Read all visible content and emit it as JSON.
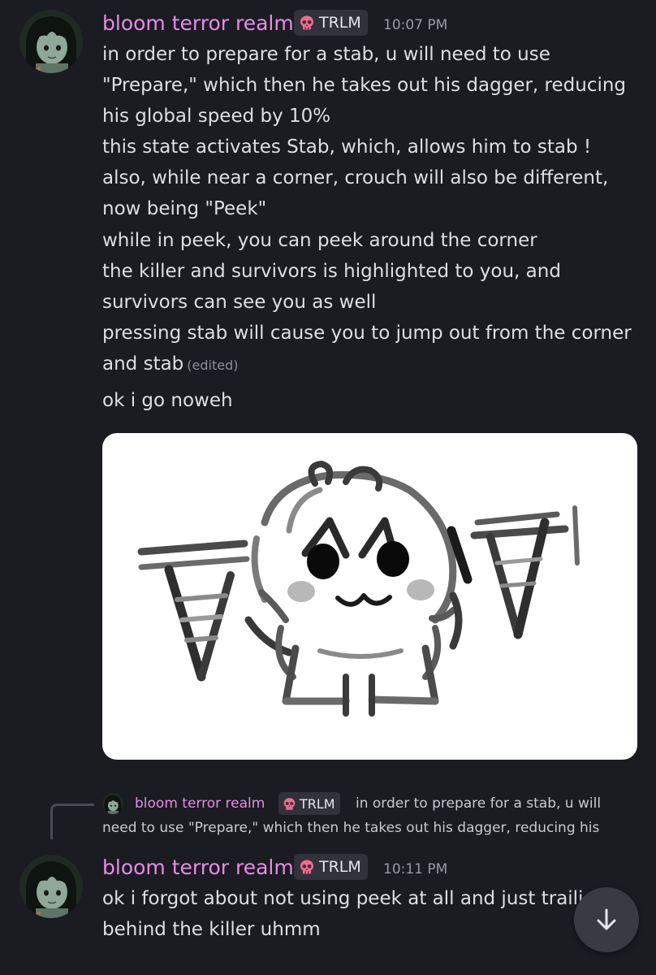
{
  "colors": {
    "background": "#1b1b22",
    "username": "#e58ce8",
    "text": "#dedee3",
    "muted": "#9a9aa3",
    "tag_bg": "#32323b"
  },
  "messages": [
    {
      "username": "bloom terror realm",
      "tag": "TRLM",
      "tag_icon": "skull-icon",
      "timestamp": "10:07 PM",
      "lines": [
        "in order to prepare for a stab, u will need to use",
        "\"Prepare,\" which then he takes out his dagger, reducing",
        "his global speed by 10%",
        "this state activates Stab, which, allows him to stab !",
        "also, while near a corner, crouch will also be different,",
        "now being \"Peek\"",
        "while in peek, you can peek around the corner",
        "the killer and survivors is highlighted to you, and",
        "survivors can see you as well",
        "pressing stab will cause you to jump out from the corner",
        "and stab"
      ],
      "edited_label": "(edited)",
      "followup": "ok i go noweh",
      "attachment_icon": "sticker-image"
    },
    {
      "reply": {
        "username": "bloom terror realm",
        "tag": "TRLM",
        "line1": "in order to prepare for a stab, u will",
        "line2": "need to use \"Prepare,\" which then he takes out his dagger, reducing his"
      },
      "username": "bloom terror realm",
      "tag": "TRLM",
      "tag_icon": "skull-icon",
      "timestamp": "10:11 PM",
      "lines": [
        "ok i forgot about not using peek at all and just traili",
        "behind the killer uhmm"
      ]
    }
  ],
  "scroll_button_icon": "arrow-down-icon"
}
